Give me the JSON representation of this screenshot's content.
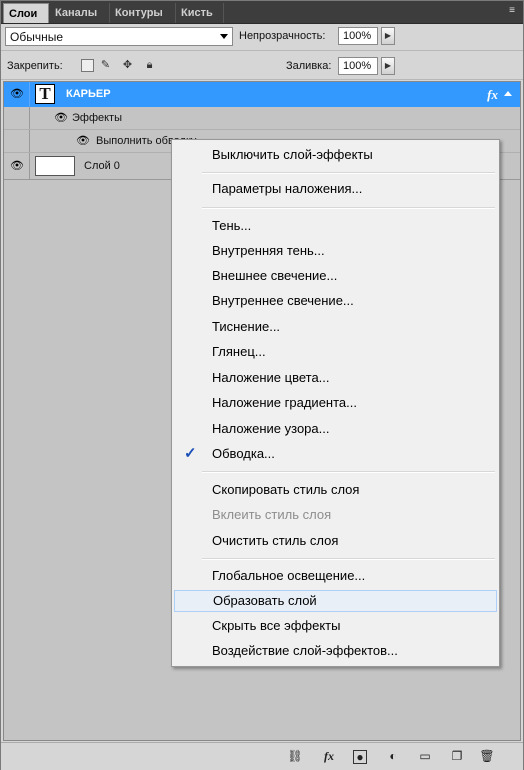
{
  "tabs": [
    {
      "label": "Слои",
      "active": true
    },
    {
      "label": "Каналы",
      "active": false
    },
    {
      "label": "Контуры",
      "active": false
    },
    {
      "label": "Кисть",
      "active": false
    }
  ],
  "options": {
    "blend_mode": "Обычные",
    "opacity_label": "Непрозрачность:",
    "opacity_value": "100%",
    "lock_label": "Закрепить:",
    "fill_label": "Заливка:",
    "fill_value": "100%"
  },
  "layers": {
    "text_layer": {
      "name": "КАРЬЕР",
      "thumb_glyph": "T",
      "fx": "fx"
    },
    "effects_label": "Эффекты",
    "stroke_effect": "Выполнить обводку",
    "layer0": {
      "name": "Слой 0"
    }
  },
  "context_menu": {
    "items": [
      {
        "label": "Выключить слой-эффекты"
      },
      {
        "label": "Параметры наложения..."
      },
      {
        "label": "Тень..."
      },
      {
        "label": "Внутренняя тень..."
      },
      {
        "label": "Внешнее свечение..."
      },
      {
        "label": "Внутреннее свечение..."
      },
      {
        "label": "Тиснение..."
      },
      {
        "label": "Глянец..."
      },
      {
        "label": "Наложение цвета..."
      },
      {
        "label": "Наложение градиента..."
      },
      {
        "label": "Наложение узора..."
      },
      {
        "label": "Обводка...",
        "checked": true
      },
      {
        "label": "Скопировать стиль слоя"
      },
      {
        "label": "Вклеить стиль слоя",
        "disabled": true
      },
      {
        "label": "Очистить стиль слоя"
      },
      {
        "label": "Глобальное освещение..."
      },
      {
        "label": "Образовать слой",
        "hover": true
      },
      {
        "label": "Скрыть все эффекты"
      },
      {
        "label": "Воздействие слой-эффектов..."
      }
    ],
    "check_glyph": "✓"
  },
  "colors": {
    "selection": "#3399ff",
    "menu_hover": "#e8eff7"
  }
}
